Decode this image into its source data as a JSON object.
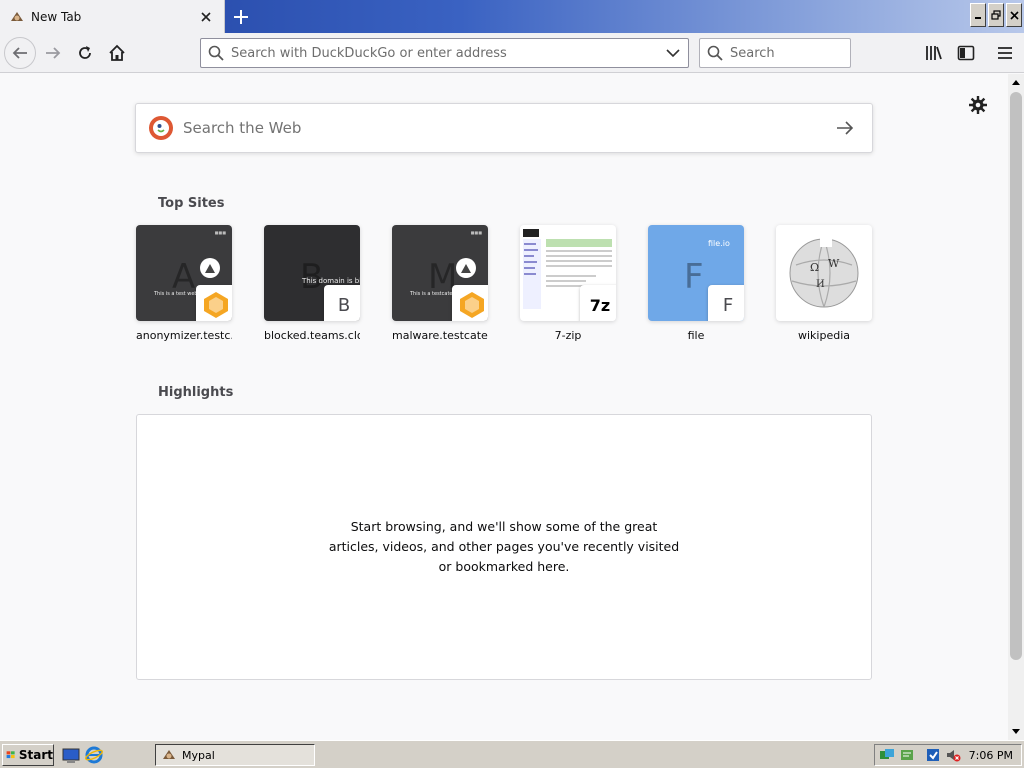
{
  "tab": {
    "title": "New Tab"
  },
  "toolbar": {
    "url_placeholder": "Search with DuckDuckGo or enter address",
    "search_placeholder": "Search"
  },
  "newtab": {
    "web_search_placeholder": "Search the Web",
    "top_sites_title": "Top Sites",
    "highlights_title": "Highlights",
    "highlights_empty": "Start browsing, and we'll show some of the great articles, videos, and other pages you've recently visited or bookmarked here.",
    "sites": [
      {
        "label": "anonymizer.testc...",
        "letter": "A",
        "thumb_caption": "This is a test website"
      },
      {
        "label": "blocked.teams.clo...",
        "letter": "B",
        "thumb_caption": "This domain is bloc"
      },
      {
        "label": "malware.testcate...",
        "letter": "M",
        "thumb_caption": "This is a testcate"
      },
      {
        "label": "7-zip",
        "letter": "7z"
      },
      {
        "label": "file",
        "letter": "F",
        "thumb_caption": "file.io"
      },
      {
        "label": "wikipedia"
      }
    ]
  },
  "taskbar": {
    "start_label": "Start",
    "task_label": "Mypal",
    "clock": "7:06 PM"
  },
  "colors": {
    "accent_blue": "#3a62c2",
    "ddg_orange": "#de5833",
    "badge_orange": "#f5a623"
  },
  "icons": [
    "back-icon",
    "forward-icon",
    "reload-icon",
    "home-icon",
    "search-icon",
    "dropdown-icon",
    "library-icon",
    "sidebar-icon",
    "menu-icon",
    "gear-icon",
    "arrow-right-icon",
    "close-icon",
    "plus-icon"
  ]
}
